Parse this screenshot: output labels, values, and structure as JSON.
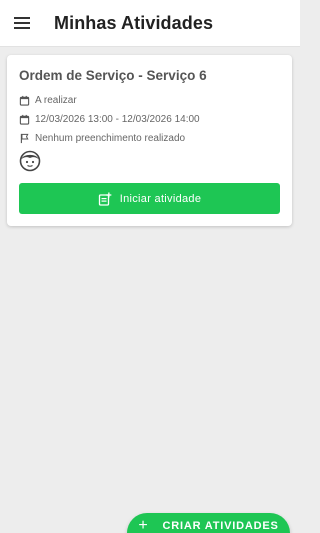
{
  "appbar": {
    "title": "Minhas Atividades",
    "menu_icon": "menu-icon"
  },
  "activities": [
    {
      "title": "Ordem de Serviço - Serviço 6",
      "status": "A realizar",
      "status_icon": "calendar-icon",
      "schedule": "12/03/2026 13:00 - 12/03/2026 14:00",
      "schedule_icon": "calendar-icon",
      "fill_status": "Nenhum preenchimento realizado",
      "fill_icon": "flag-icon",
      "avatar_icon": "face-icon",
      "start_button_label": "Iniciar atividade",
      "start_button_icon": "note-add-icon"
    }
  ],
  "fab": {
    "label": "CRIAR ATIVIDADES",
    "icon": "plus-icon"
  },
  "colors": {
    "accent": "#1ec654",
    "background": "#ededed",
    "card": "#ffffff"
  }
}
